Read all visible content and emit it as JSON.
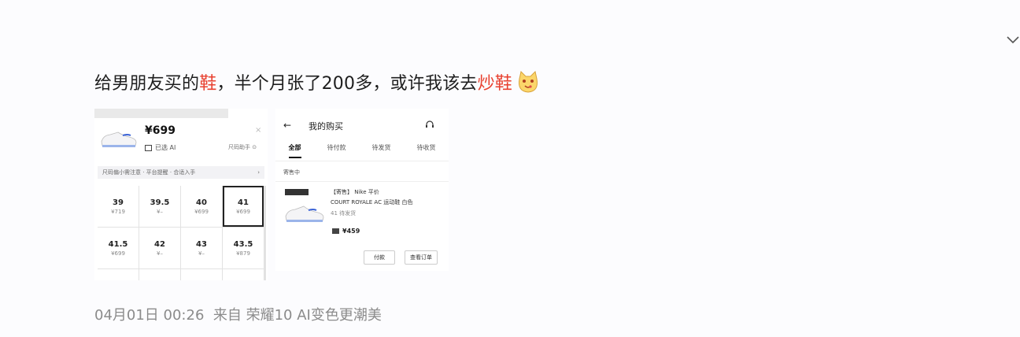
{
  "post": {
    "text_a": "给男朋友买的",
    "text_hl1": "鞋",
    "text_b": "，半个月张了200多，或许我该去",
    "text_hl2": "炒鞋",
    "emoji": "cat-face-emoji"
  },
  "left_shot": {
    "price": "¥699",
    "selected_label": "已选 AI",
    "right_hint": "尺码助手 ⊙",
    "notice": "尺码偏小需注意 · 平台提醒 · 合适入手",
    "notice_arrow": "›",
    "close": "×",
    "sizes": [
      {
        "size": "39",
        "price": "¥719"
      },
      {
        "size": "39.5",
        "price": "¥–"
      },
      {
        "size": "40",
        "price": "¥699"
      },
      {
        "size": "41",
        "price": "¥699",
        "selected": true
      },
      {
        "size": "41.5",
        "price": "¥699"
      },
      {
        "size": "42",
        "price": "¥–"
      },
      {
        "size": "43",
        "price": "¥–"
      },
      {
        "size": "43.5",
        "price": "¥879"
      }
    ]
  },
  "right_shot": {
    "back": "←",
    "title": "我的购买",
    "tabs": [
      {
        "label": "全部",
        "active": true
      },
      {
        "label": "待付款"
      },
      {
        "label": "待发货"
      },
      {
        "label": "待收货"
      }
    ],
    "status": "寄售中",
    "order_title": "【寄售】 Nike 平价",
    "order_title2": "COURT ROYALE AC 运动鞋 白色",
    "order_sub": "41 待发货",
    "order_price": "¥459",
    "btn1": "付款",
    "btn2": "查看订单"
  },
  "meta": {
    "date": "04月01日 00:26",
    "source_prefix": "来自",
    "device": "荣耀10 AI变色更潮美"
  },
  "colors": {
    "highlight": "#e8402f",
    "meta_gray": "#8b8b8b"
  }
}
